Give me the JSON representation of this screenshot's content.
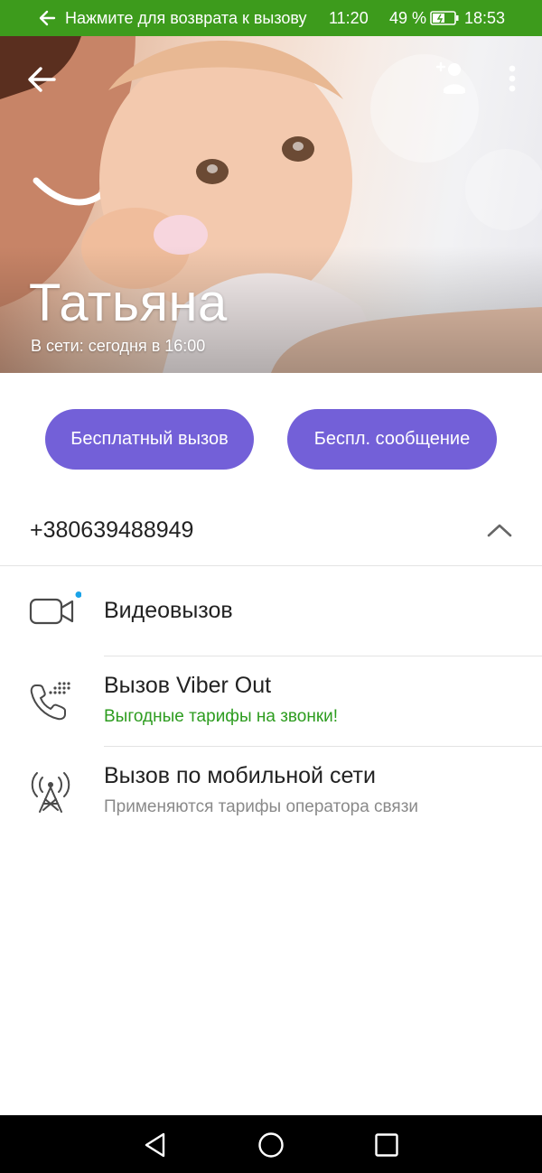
{
  "status_bar": {
    "return_to_call": "Нажмите для возврата к вызову",
    "call_time": "11:20",
    "battery_percent": "49 %",
    "time": "18:53",
    "background_color": "#3d9b1c"
  },
  "header": {
    "contact_name": "Татьяна",
    "last_seen": "В сети: сегодня в 16:00",
    "icons": [
      "back-arrow-icon",
      "add-contact-icon",
      "more-vert-icon"
    ]
  },
  "actions": {
    "free_call_label": "Бесплатный вызов",
    "free_message_label": "Беспл. сообщение",
    "accent_color": "#7360d8"
  },
  "phone": {
    "number": "+380639488949",
    "expanded": true
  },
  "options": [
    {
      "title": "Видеовызов",
      "subtitle": "",
      "icon": "video-camera-icon"
    },
    {
      "title": "Вызов Viber Out",
      "subtitle": "Выгодные тарифы на звонки!",
      "subtitle_color": "#2d9c1f",
      "icon": "phone-dial-icon"
    },
    {
      "title": "Вызов по мобильной сети",
      "subtitle": "Применяются тарифы оператора связи",
      "subtitle_color": "#8a8a8a",
      "icon": "cell-tower-icon"
    }
  ],
  "nav_bar": {
    "buttons": [
      "back-triangle-icon",
      "home-circle-icon",
      "recents-square-icon"
    ]
  }
}
